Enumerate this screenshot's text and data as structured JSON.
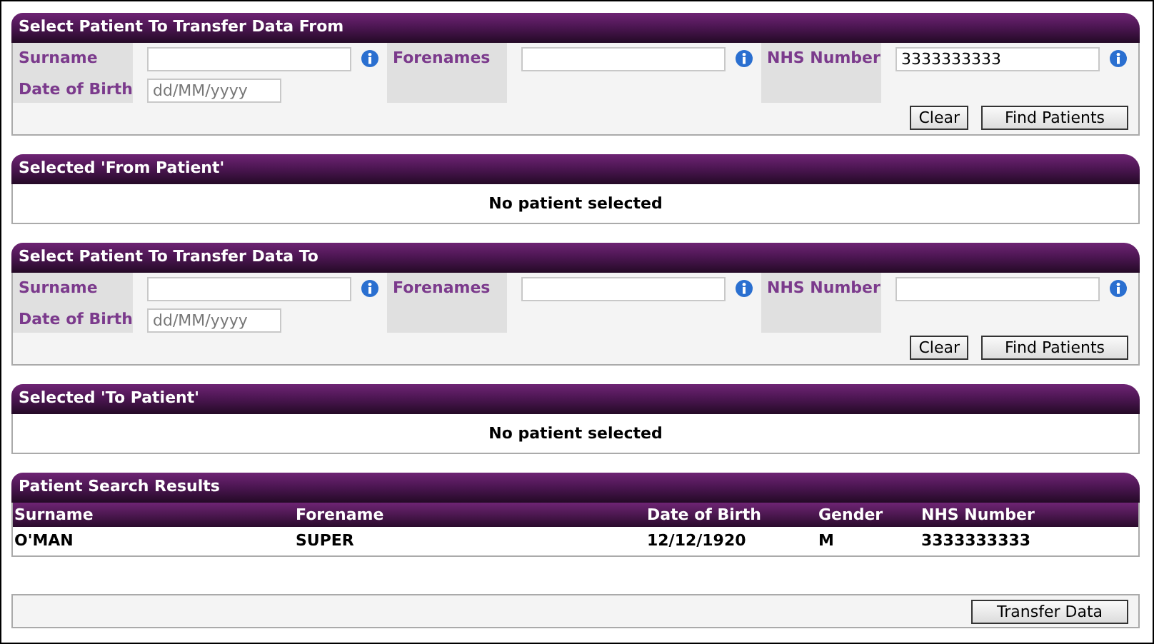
{
  "sections": [
    {
      "kind": "search",
      "title": "Select Patient To Transfer Data From",
      "fields": [
        {
          "label": "Surname"
        },
        {
          "label": "Forenames"
        },
        {
          "label": "NHS Number",
          "value": "3333333333"
        }
      ],
      "date_field": {
        "label": "Date of Birth",
        "placeholder": "dd/MM/yyyy"
      },
      "buttons": [
        "Clear",
        "Find Patients"
      ]
    },
    {
      "kind": "selected",
      "title": "Selected 'From Patient'",
      "message": "No patient selected"
    },
    {
      "kind": "search",
      "title": "Select Patient To Transfer Data To",
      "fields": [
        {
          "label": "Surname"
        },
        {
          "label": "Forenames"
        },
        {
          "label": "NHS Number"
        }
      ],
      "date_field": {
        "label": "Date of Birth",
        "placeholder": "dd/MM/yyyy"
      },
      "buttons": [
        "Clear",
        "Find Patients"
      ]
    },
    {
      "kind": "selected",
      "title": "Selected 'To Patient'",
      "message": "No patient selected"
    },
    {
      "kind": "results",
      "title": "Patient Search Results",
      "columns": [
        "Surname",
        "Forename",
        "Date of Birth",
        "Gender",
        "NHS Number"
      ],
      "rows": [
        [
          "O'MAN",
          "SUPER",
          "12/12/1920",
          "M",
          "3333333333"
        ]
      ]
    }
  ],
  "action_button": "Transfer Data"
}
